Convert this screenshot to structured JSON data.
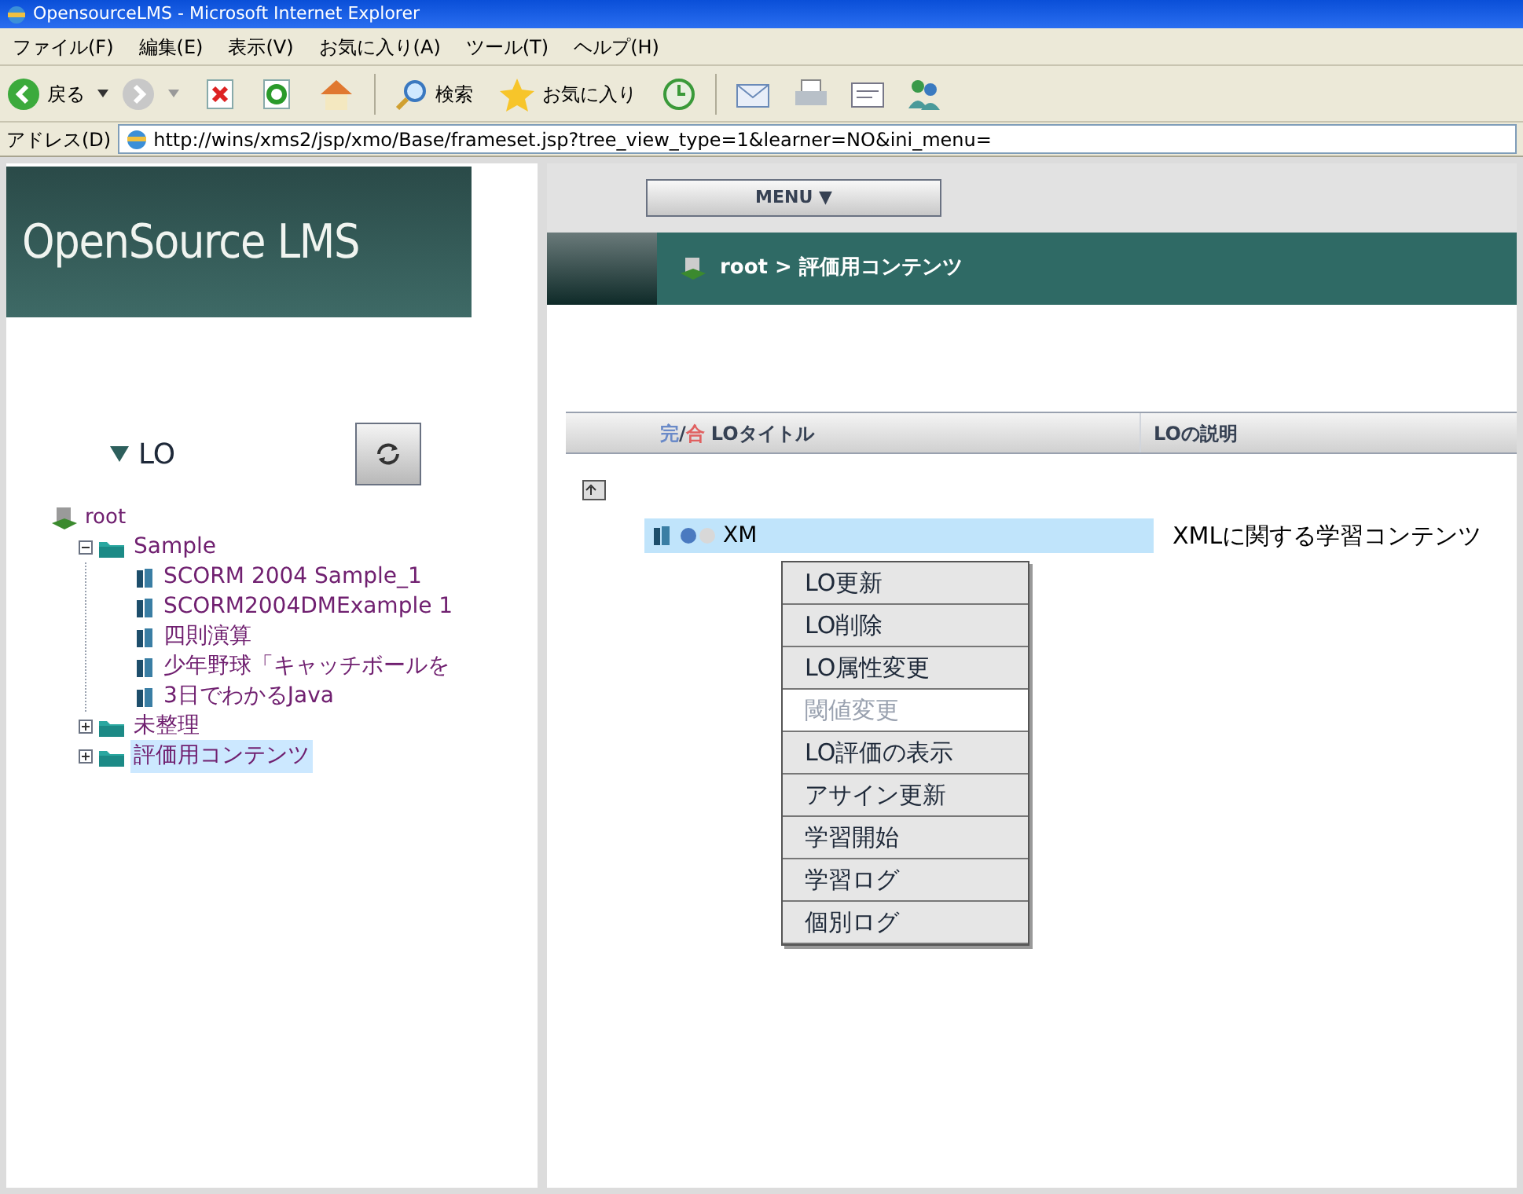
{
  "window": {
    "title": "OpensourceLMS - Microsoft Internet Explorer"
  },
  "menu_bar": [
    "ファイル(F)",
    "編集(E)",
    "表示(V)",
    "お気に入り(A)",
    "ツール(T)",
    "ヘルプ(H)"
  ],
  "toolbar": {
    "back": "戻る",
    "search": "検索",
    "favorites": "お気に入り"
  },
  "address_bar": {
    "label": "アドレス(D)",
    "value": "http://wins/xms2/jsp/xmo/Base/frameset.jsp?tree_view_type=1&learner=NO&ini_menu="
  },
  "sidebar": {
    "logo": "OpenSource LMS",
    "section": {
      "label": "LO",
      "expanded": true
    },
    "tree": [
      {
        "label": "root",
        "kind": "root",
        "children": [
          {
            "label": "Sample",
            "kind": "folder",
            "expanded": true,
            "selected": false,
            "children": [
              {
                "label": "SCORM 2004 Sample_1",
                "kind": "item"
              },
              {
                "label": "SCORM2004DMExample 1",
                "kind": "item"
              },
              {
                "label": "四則演算",
                "kind": "item"
              },
              {
                "label": "少年野球「キャッチボールを",
                "kind": "item"
              },
              {
                "label": "3日でわかるJava",
                "kind": "item"
              }
            ]
          },
          {
            "label": "未整理",
            "kind": "folder",
            "expanded": false,
            "selected": false
          },
          {
            "label": "評価用コンテンツ",
            "kind": "folder",
            "expanded": false,
            "selected": true
          }
        ]
      }
    ]
  },
  "header": {
    "menu_button": "MENU ▼",
    "breadcrumb": "root > 評価用コンテンツ"
  },
  "table": {
    "columns": [
      {
        "parts": [
          "完",
          "/",
          "合"
        ],
        "label": "LOタイトル"
      },
      {
        "label": "LOの説明"
      }
    ],
    "rows": [
      {
        "title": "XM",
        "description": "XMLに関する学習コンテンツ",
        "selected": true
      }
    ]
  },
  "context_menu": [
    {
      "label": "LO更新",
      "disabled": false
    },
    {
      "label": "LO削除",
      "disabled": false
    },
    {
      "label": "LO属性変更",
      "disabled": false
    },
    {
      "label": "閾値変更",
      "disabled": true
    },
    {
      "label": "LO評価の表示",
      "disabled": false
    },
    {
      "label": "アサイン更新",
      "disabled": false
    },
    {
      "label": "学習開始",
      "disabled": false
    },
    {
      "label": "学習ログ",
      "disabled": false
    },
    {
      "label": "個別ログ",
      "disabled": false
    }
  ]
}
